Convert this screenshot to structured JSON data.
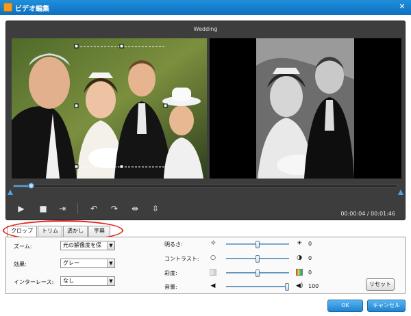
{
  "window": {
    "title": "ビデオ編集",
    "close_glyph": "✕"
  },
  "player": {
    "video_title": "Wedding",
    "playback_progress_fraction": 0.045,
    "time_readout": "00:00:04 / 00:01:46"
  },
  "controls": [
    {
      "name": "play-button",
      "glyph": "▶"
    },
    {
      "name": "stop-button",
      "glyph": "■"
    },
    {
      "name": "export-frame-button",
      "glyph": "⇥"
    },
    {
      "name": "rotate-left-button",
      "glyph": "↶"
    },
    {
      "name": "rotate-right-button",
      "glyph": "↷"
    },
    {
      "name": "flip-horizontal-button",
      "glyph": "⇹"
    },
    {
      "name": "flip-vertical-button",
      "glyph": "⇳"
    }
  ],
  "tabs": [
    {
      "label": "クロップ",
      "active": true
    },
    {
      "label": "トリム",
      "active": false
    },
    {
      "label": "透かし",
      "active": false
    },
    {
      "label": "字幕",
      "active": false
    }
  ],
  "left_settings": [
    {
      "label": "ズーム:",
      "value": "元の解像度を保"
    },
    {
      "label": "効果:",
      "value": "グレー"
    },
    {
      "label": "インターレース:",
      "value": "なし"
    }
  ],
  "adjustments": [
    {
      "label": "明るさ:",
      "value": "0",
      "level_fraction": 0.5
    },
    {
      "label": "コントラスト:",
      "value": "0",
      "level_fraction": 0.5
    },
    {
      "label": "彩度:",
      "value": "0",
      "level_fraction": 0.5
    },
    {
      "label": "音量:",
      "value": "100",
      "level_fraction": 1.0
    }
  ],
  "buttons": {
    "reset": "リセット",
    "ok": "OK",
    "cancel": "キャンセル"
  },
  "colors": {
    "titlebar": "#1580d0",
    "highlight_oval": "#e0251f",
    "accent": "#4ea3e6"
  }
}
